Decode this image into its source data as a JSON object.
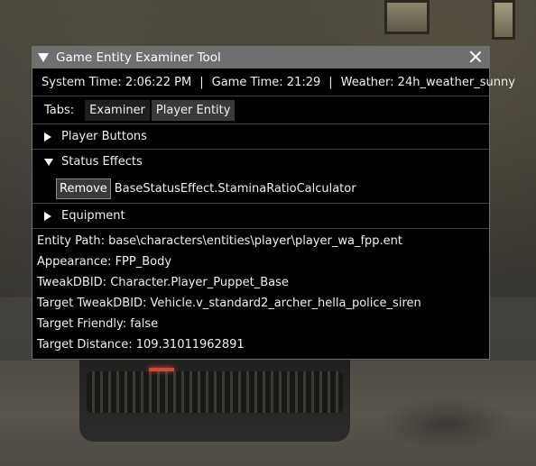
{
  "window": {
    "title": "Game Entity Examiner Tool"
  },
  "status": {
    "system_time": "System Time: 2:06:22 PM",
    "game_time": "Game Time: 21:29",
    "weather": "Weather: 24h_weather_sunny",
    "separator": "|"
  },
  "tabs": {
    "label": "Tabs:",
    "items": [
      {
        "label": "Examiner",
        "active": false
      },
      {
        "label": "Player Entity",
        "active": true
      }
    ]
  },
  "sections": {
    "player_buttons": "Player Buttons",
    "status_effects": "Status Effects",
    "equipment": "Equipment"
  },
  "status_effects": [
    {
      "button_label": "Remove",
      "name": "BaseStatusEffect.StaminaRatioCalculator"
    }
  ],
  "entity_info": {
    "path": "Entity Path: base\\characters\\entities\\player\\player_wa_fpp.ent",
    "appearance": "Appearance: FPP_Body",
    "tweakdbid": "TweakDBID: Character.Player_Puppet_Base",
    "target_tweakdbid": "Target TweakDBID: Vehicle.v_standard2_archer_hella_police_siren",
    "target_friendly": "Target Friendly: false",
    "target_distance": "Target Distance: 109.31011962891"
  }
}
